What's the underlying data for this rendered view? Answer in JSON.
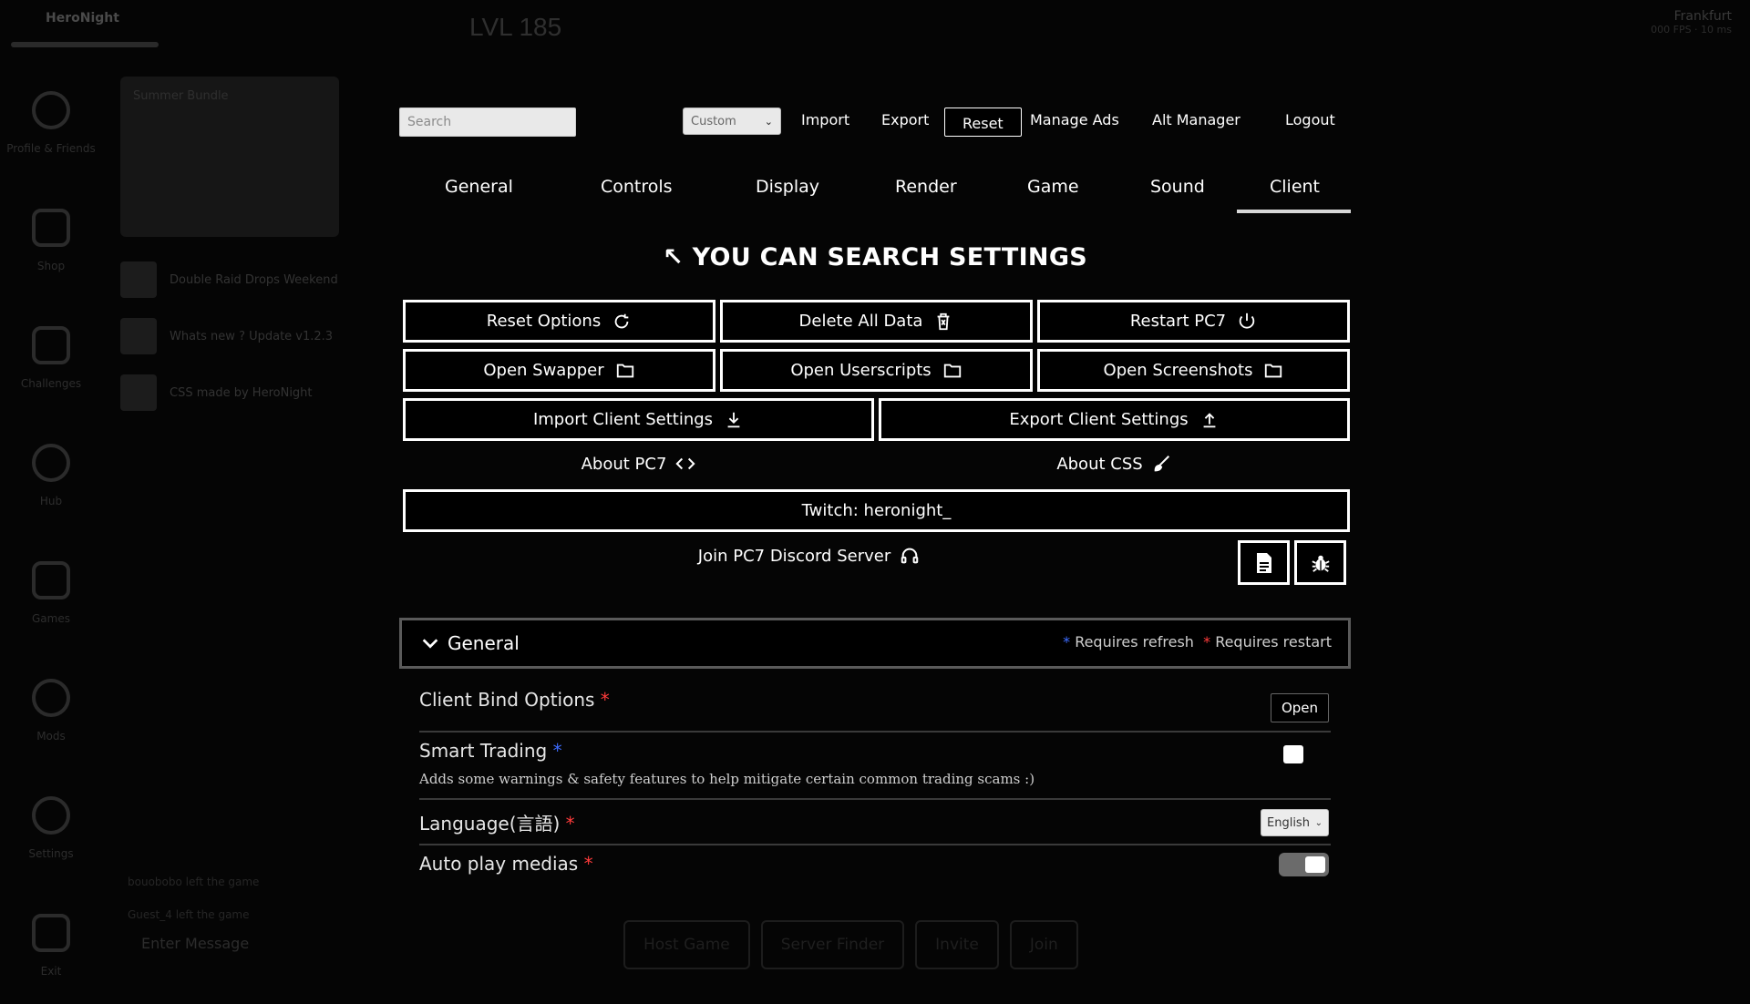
{
  "background": {
    "username": "HeroNight",
    "level": "LVL 185",
    "region": "Frankfurt",
    "region_sub": "000 FPS · 10 ms",
    "nav": [
      "Profile & Friends",
      "Shop",
      "Challenges",
      "Hub",
      "Games",
      "Mods",
      "Settings",
      "Exit"
    ],
    "news_card": "Summer Bundle",
    "news_items": [
      "Double Raid Drops Weekend",
      "Whats new ? Update v1.2.3",
      "CSS made by HeroNight"
    ],
    "chat_lines": [
      "bouobobo left the game",
      "Guest_4 left the game"
    ],
    "chat_placeholder": "Enter Message",
    "bottom_buttons": [
      "Host Game",
      "Server Finder",
      "Invite",
      "Join"
    ]
  },
  "topbar": {
    "search_placeholder": "Search",
    "preset": "Custom",
    "import": "Import",
    "export": "Export",
    "reset": "Reset",
    "manage_ads": "Manage Ads",
    "alt_manager": "Alt Manager",
    "logout": "Logout"
  },
  "tabs": [
    "General",
    "Controls",
    "Display",
    "Render",
    "Game",
    "Sound",
    "Client"
  ],
  "active_tab": "Client",
  "search_hint": "↖ YOU CAN SEARCH SETTINGS",
  "actions": {
    "reset_options": "Reset Options",
    "delete_all_data": "Delete All Data",
    "restart_pc7": "Restart PC7",
    "open_swapper": "Open Swapper",
    "open_userscripts": "Open Userscripts",
    "open_screenshots": "Open Screenshots",
    "import_client_settings": "Import Client Settings",
    "export_client_settings": "Export Client Settings",
    "about_pc7": "About PC7",
    "about_css": "About CSS",
    "twitch": "Twitch: heronight_",
    "join_discord": "Join PC7 Discord Server"
  },
  "section": {
    "title": "General",
    "legend_refresh": "Requires refresh",
    "legend_restart": "Requires restart"
  },
  "settings": {
    "client_bind": {
      "label": "Client Bind Options",
      "button": "Open"
    },
    "smart_trading": {
      "label": "Smart Trading",
      "description": "Adds some warnings & safety features to help mitigate certain common trading scams :)",
      "checked": false
    },
    "language": {
      "label": "Language(言語)",
      "value": "English"
    },
    "auto_play": {
      "label": "Auto play medias",
      "enabled": true
    }
  },
  "colors": {
    "requires_refresh": "#3d6cff",
    "requires_restart": "#ff3b3b"
  }
}
